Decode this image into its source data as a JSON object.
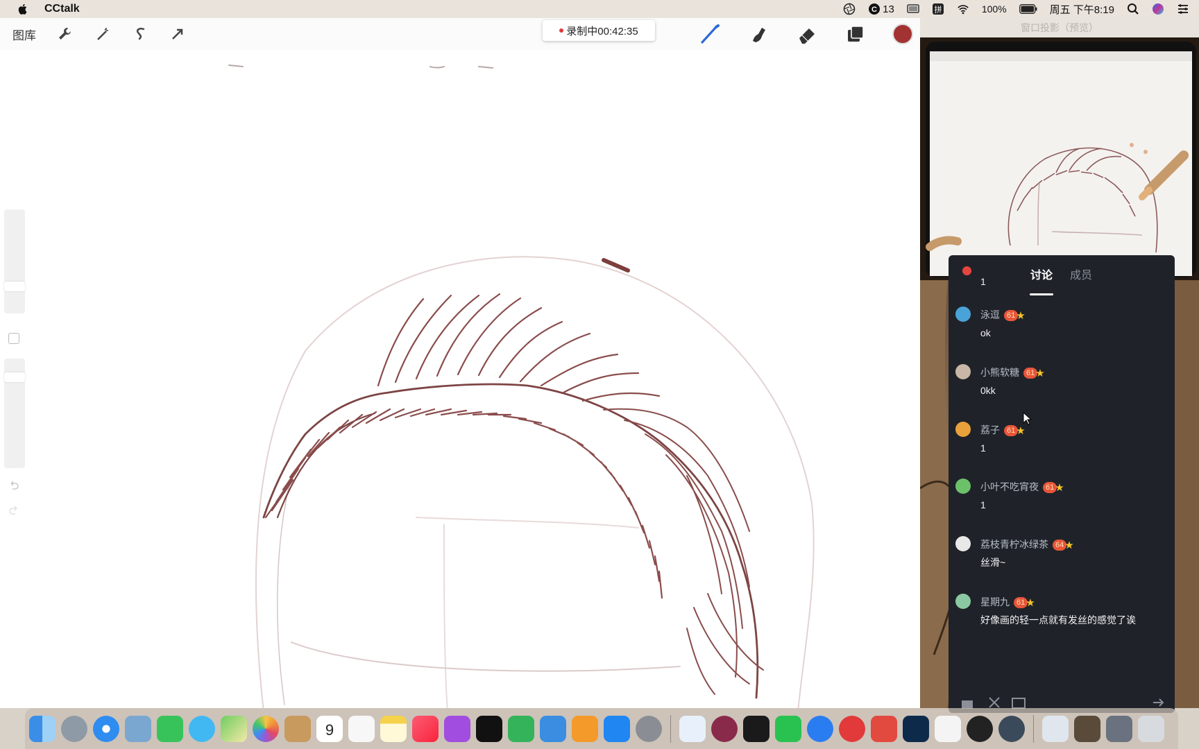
{
  "menubar": {
    "app_name": "CCtalk",
    "notif_count": "13",
    "battery": "100%",
    "clock": "周五 下午8:19"
  },
  "procreate": {
    "gallery_label": "图库",
    "recording_label": "录制中00:42:35",
    "brush_color": "#a33232"
  },
  "projection": {
    "window_title": "窗口投影（预览）"
  },
  "chat": {
    "tabs": [
      "讨论",
      "成员"
    ],
    "active_tab": "讨论",
    "partial_top_text": "1",
    "messages": [
      {
        "user": "泳逗",
        "level": "61",
        "text": "ok",
        "avatar_color": "#4aa3d8"
      },
      {
        "user": "小熊软糖",
        "level": "61",
        "text": "0kk",
        "avatar_color": "#c9b6a6"
      },
      {
        "user": "荔子",
        "level": "61",
        "text": "1",
        "avatar_color": "#e9a23b"
      },
      {
        "user": "小叶不吃宵夜",
        "level": "61",
        "text": "1",
        "avatar_color": "#6cc06a"
      },
      {
        "user": "荔枝青柠冰绿茶",
        "level": "64",
        "text": "丝滑~",
        "avatar_color": "#e8e8e8"
      },
      {
        "user": "星期九",
        "level": "61",
        "text": "好像画的轻一点就有发丝的感觉了诶",
        "avatar_color": "#8bc9a2"
      }
    ]
  },
  "dock": {
    "calendar_day": "9",
    "apps": [
      "finder",
      "launchpad",
      "safari",
      "preview",
      "facetime",
      "messages",
      "maps",
      "photos",
      "notebook",
      "calendar",
      "reminders",
      "notes",
      "music",
      "podcasts",
      "tv",
      "numbers",
      "keynote",
      "pages",
      "app-store",
      "system-preferences",
      "baidu-netdisk",
      "affinity",
      "terminal",
      "wechat",
      "qq-browser",
      "netease-music",
      "wps",
      "photoshop",
      "cctalk",
      "obs",
      "quicktime",
      "screenshot",
      "image-viewer",
      "display",
      "trash"
    ]
  }
}
